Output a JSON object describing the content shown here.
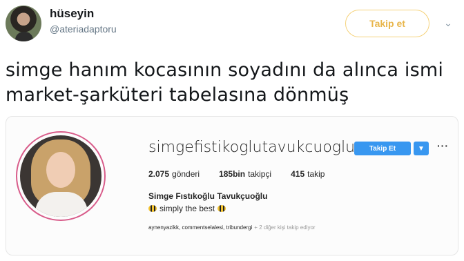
{
  "tweet": {
    "display_name": "hüseyin",
    "handle": "@ateriadaptoru",
    "follow_label": "Takip et",
    "dropdown_icon": "chevron-down-icon",
    "text_line1": "simge hanım kocasının soyadını da alınca ismi",
    "text_line2": "market-şarküteri tabelasına dönmüş"
  },
  "instagram": {
    "username": "simgefistikoglutavukcuoglu",
    "follow_label": "Takip Et",
    "more_label": "···",
    "stats": [
      {
        "value": "2.075",
        "label": "gönderi"
      },
      {
        "value": "185bin",
        "label": "takipçi"
      },
      {
        "value": "415",
        "label": "takip"
      }
    ],
    "full_name": "Simge Fıstıkoğlu Tavukçuoğlu",
    "bio": "simply the best",
    "followed_by": {
      "names": "aynenyazikk, commentselalesi, tribundergi",
      "suffix": "+ 2 diğer kişi takip ediyor"
    }
  },
  "colors": {
    "follow_outline": "#f5d27a",
    "follow_text": "#e8b64c",
    "ig_blue": "#3897f0",
    "ig_ring": "#d85c8a"
  }
}
